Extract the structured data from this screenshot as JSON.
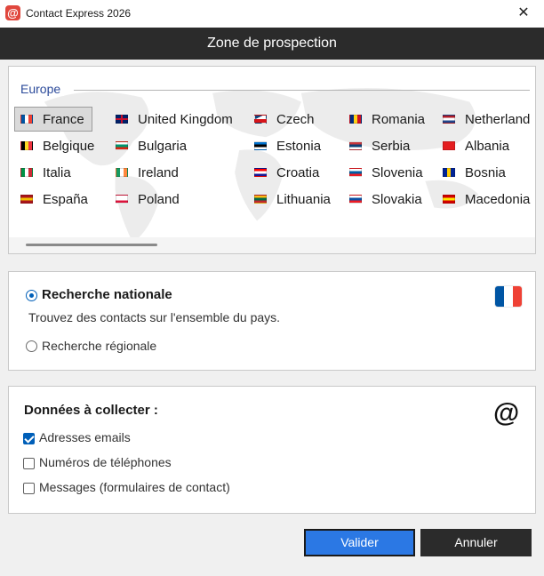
{
  "window": {
    "title": "Contact Express 2026",
    "icon_glyph": "@",
    "close_glyph": "✕"
  },
  "header": {
    "title": "Zone de prospection"
  },
  "countries": {
    "region_label": "Europe",
    "items": [
      {
        "label": "France",
        "selected": true,
        "flag": [
          "#0055a4",
          "#ffffff",
          "#ef4135"
        ],
        "dir": "v"
      },
      {
        "label": "United Kingdom",
        "selected": false,
        "flag": [
          "#012169",
          "#ffffff",
          "#c8102e"
        ],
        "dir": "uk"
      },
      {
        "label": "Czech",
        "selected": false,
        "flag": [
          "#ffffff",
          "#d7141a",
          "#11457e"
        ],
        "dir": "cz"
      },
      {
        "label": "Romania",
        "selected": false,
        "flag": [
          "#002b7f",
          "#fcd116",
          "#ce1126"
        ],
        "dir": "v"
      },
      {
        "label": "Netherland",
        "selected": false,
        "flag": [
          "#ae1c28",
          "#ffffff",
          "#21468b"
        ],
        "dir": "h"
      },
      {
        "label": "Belgique",
        "selected": false,
        "flag": [
          "#000000",
          "#fdda24",
          "#ef3340"
        ],
        "dir": "v"
      },
      {
        "label": "Bulgaria",
        "selected": false,
        "flag": [
          "#ffffff",
          "#00966e",
          "#d62612"
        ],
        "dir": "h"
      },
      {
        "label": "Estonia",
        "selected": false,
        "flag": [
          "#0072ce",
          "#000000",
          "#ffffff"
        ],
        "dir": "h"
      },
      {
        "label": "Serbia",
        "selected": false,
        "flag": [
          "#c6363c",
          "#0c4076",
          "#ffffff"
        ],
        "dir": "h"
      },
      {
        "label": "Albania",
        "selected": false,
        "flag": [
          "#e41e20",
          "#e41e20",
          "#e41e20"
        ],
        "dir": "h"
      },
      {
        "label": "Italia",
        "selected": false,
        "flag": [
          "#009246",
          "#ffffff",
          "#ce2b37"
        ],
        "dir": "v"
      },
      {
        "label": "Ireland",
        "selected": false,
        "flag": [
          "#169b62",
          "#ffffff",
          "#ff883e"
        ],
        "dir": "v"
      },
      {
        "label": "Croatia",
        "selected": false,
        "flag": [
          "#ff0000",
          "#ffffff",
          "#171796"
        ],
        "dir": "h"
      },
      {
        "label": "Slovenia",
        "selected": false,
        "flag": [
          "#ffffff",
          "#005da4",
          "#ed1c24"
        ],
        "dir": "h"
      },
      {
        "label": "Bosnia",
        "selected": false,
        "flag": [
          "#002395",
          "#fecb00",
          "#002395"
        ],
        "dir": "v"
      },
      {
        "label": "España",
        "selected": false,
        "flag": [
          "#aa151b",
          "#f1bf00",
          "#aa151b"
        ],
        "dir": "h"
      },
      {
        "label": "Poland",
        "selected": false,
        "flag": [
          "#ffffff",
          "#ffffff",
          "#dc143c"
        ],
        "dir": "h"
      },
      {
        "label": "Lithuania",
        "selected": false,
        "flag": [
          "#fdb913",
          "#006a44",
          "#c1272d"
        ],
        "dir": "h"
      },
      {
        "label": "Slovakia",
        "selected": false,
        "flag": [
          "#ffffff",
          "#0b4ea2",
          "#ee1c25"
        ],
        "dir": "h"
      },
      {
        "label": "Macedonia",
        "selected": false,
        "flag": [
          "#d20000",
          "#ffe600",
          "#d20000"
        ],
        "dir": "h"
      }
    ]
  },
  "search": {
    "national_label": "Recherche nationale",
    "national_desc": "Trouvez des contacts sur l'ensemble du pays.",
    "regional_label": "Recherche régionale",
    "national_selected": true,
    "flag_colors": [
      "#0055a4",
      "#ffffff",
      "#ef4135"
    ]
  },
  "data_collect": {
    "title": "Données à collecter :",
    "icon_glyph": "@",
    "options": [
      {
        "label": "Adresses emails",
        "checked": true
      },
      {
        "label": "Numéros de téléphones",
        "checked": false
      },
      {
        "label": "Messages (formulaires de contact)",
        "checked": false
      }
    ]
  },
  "buttons": {
    "validate_label": "Valider",
    "cancel_label": "Annuler"
  },
  "colors": {
    "accent": "#2b78e4",
    "header_bg": "#2b2b2b",
    "region_label": "#2b4a9a"
  }
}
